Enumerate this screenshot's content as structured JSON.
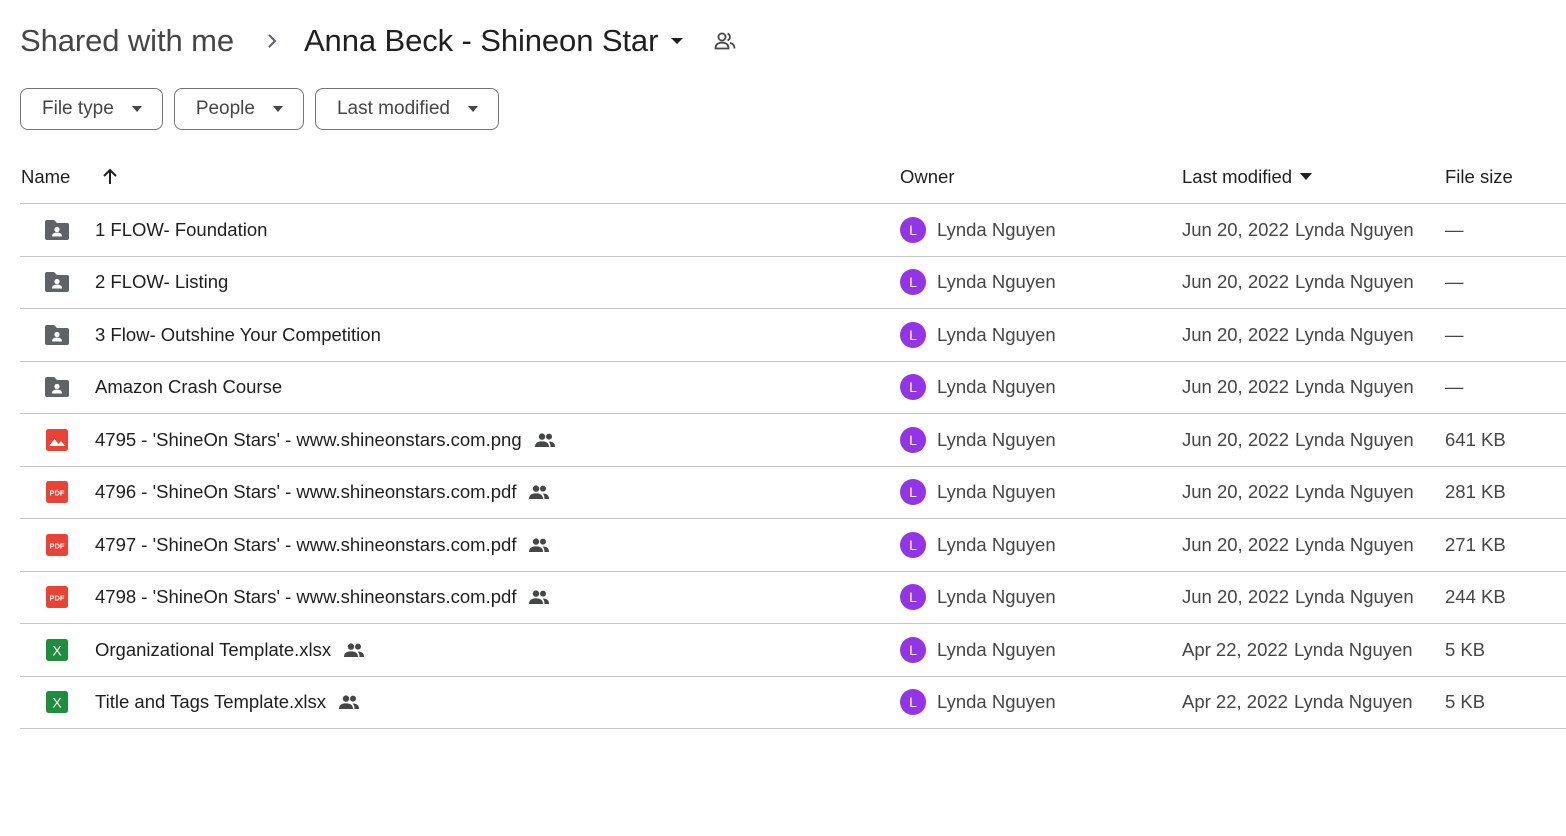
{
  "breadcrumb": {
    "root": "Shared with me",
    "separator_icon": "chevron-right-icon",
    "current": "Anna Beck - Shineon Star",
    "caret_icon": "arrow-drop-down-icon",
    "shared_icon": "people-outline-icon"
  },
  "filters": [
    {
      "label": "File type",
      "icon": "arrow-drop-down-icon"
    },
    {
      "label": "People",
      "icon": "arrow-drop-down-icon"
    },
    {
      "label": "Last modified",
      "icon": "arrow-drop-down-icon"
    }
  ],
  "table": {
    "columns": {
      "name": "Name",
      "name_sort_icon": "arrow-upward-icon",
      "owner": "Owner",
      "modified": "Last modified",
      "modified_sort_icon": "arrow-drop-down-icon",
      "size": "File size"
    },
    "rows": [
      {
        "type": "shared-folder",
        "icon": "shared-folder-icon",
        "name": "1 FLOW- Foundation",
        "shared": false,
        "owner": "Lynda Nguyen",
        "owner_initial": "L",
        "date": "Jun 20, 2022",
        "modified_by": "Lynda Nguyen",
        "size": "—"
      },
      {
        "type": "shared-folder",
        "icon": "shared-folder-icon",
        "name": "2 FLOW- Listing",
        "shared": false,
        "owner": "Lynda Nguyen",
        "owner_initial": "L",
        "date": "Jun 20, 2022",
        "modified_by": "Lynda Nguyen",
        "size": "—"
      },
      {
        "type": "shared-folder",
        "icon": "shared-folder-icon",
        "name": "3 Flow- Outshine Your Competition",
        "shared": false,
        "owner": "Lynda Nguyen",
        "owner_initial": "L",
        "date": "Jun 20, 2022",
        "modified_by": "Lynda Nguyen",
        "size": "—"
      },
      {
        "type": "shared-folder",
        "icon": "shared-folder-icon",
        "name": "Amazon Crash Course",
        "shared": false,
        "owner": "Lynda Nguyen",
        "owner_initial": "L",
        "date": "Jun 20, 2022",
        "modified_by": "Lynda Nguyen",
        "size": "—"
      },
      {
        "type": "image",
        "icon": "image-file-icon",
        "name": "4795 - 'ShineOn Stars' - www.shineonstars.com.png",
        "shared": true,
        "owner": "Lynda Nguyen",
        "owner_initial": "L",
        "date": "Jun 20, 2022",
        "modified_by": "Lynda Nguyen",
        "size": "641 KB"
      },
      {
        "type": "pdf",
        "icon": "pdf-file-icon",
        "name": "4796 - 'ShineOn Stars' - www.shineonstars.com.pdf",
        "shared": true,
        "owner": "Lynda Nguyen",
        "owner_initial": "L",
        "date": "Jun 20, 2022",
        "modified_by": "Lynda Nguyen",
        "size": "281 KB"
      },
      {
        "type": "pdf",
        "icon": "pdf-file-icon",
        "name": "4797 - 'ShineOn Stars' - www.shineonstars.com.pdf",
        "shared": true,
        "owner": "Lynda Nguyen",
        "owner_initial": "L",
        "date": "Jun 20, 2022",
        "modified_by": "Lynda Nguyen",
        "size": "271 KB"
      },
      {
        "type": "pdf",
        "icon": "pdf-file-icon",
        "name": "4798 - 'ShineOn Stars' - www.shineonstars.com.pdf",
        "shared": true,
        "owner": "Lynda Nguyen",
        "owner_initial": "L",
        "date": "Jun 20, 2022",
        "modified_by": "Lynda Nguyen",
        "size": "244 KB"
      },
      {
        "type": "sheet",
        "icon": "spreadsheet-file-icon",
        "name": "Organizational Template.xlsx",
        "shared": true,
        "owner": "Lynda Nguyen",
        "owner_initial": "L",
        "date": "Apr 22, 2022",
        "modified_by": "Lynda Nguyen",
        "size": "5 KB"
      },
      {
        "type": "sheet",
        "icon": "spreadsheet-file-icon",
        "name": "Title and Tags Template.xlsx",
        "shared": true,
        "owner": "Lynda Nguyen",
        "owner_initial": "L",
        "date": "Apr 22, 2022",
        "modified_by": "Lynda Nguyen",
        "size": "5 KB"
      }
    ]
  },
  "colors": {
    "avatar": "#9334e6",
    "folder": "#5f6368",
    "image_icon": "#ea4335",
    "pdf_icon": "#ea4335",
    "sheet_icon": "#1e8e3e",
    "icon_text": "#444746"
  },
  "icon_glyphs": {
    "pdf": "PDF",
    "sheet": "X"
  }
}
